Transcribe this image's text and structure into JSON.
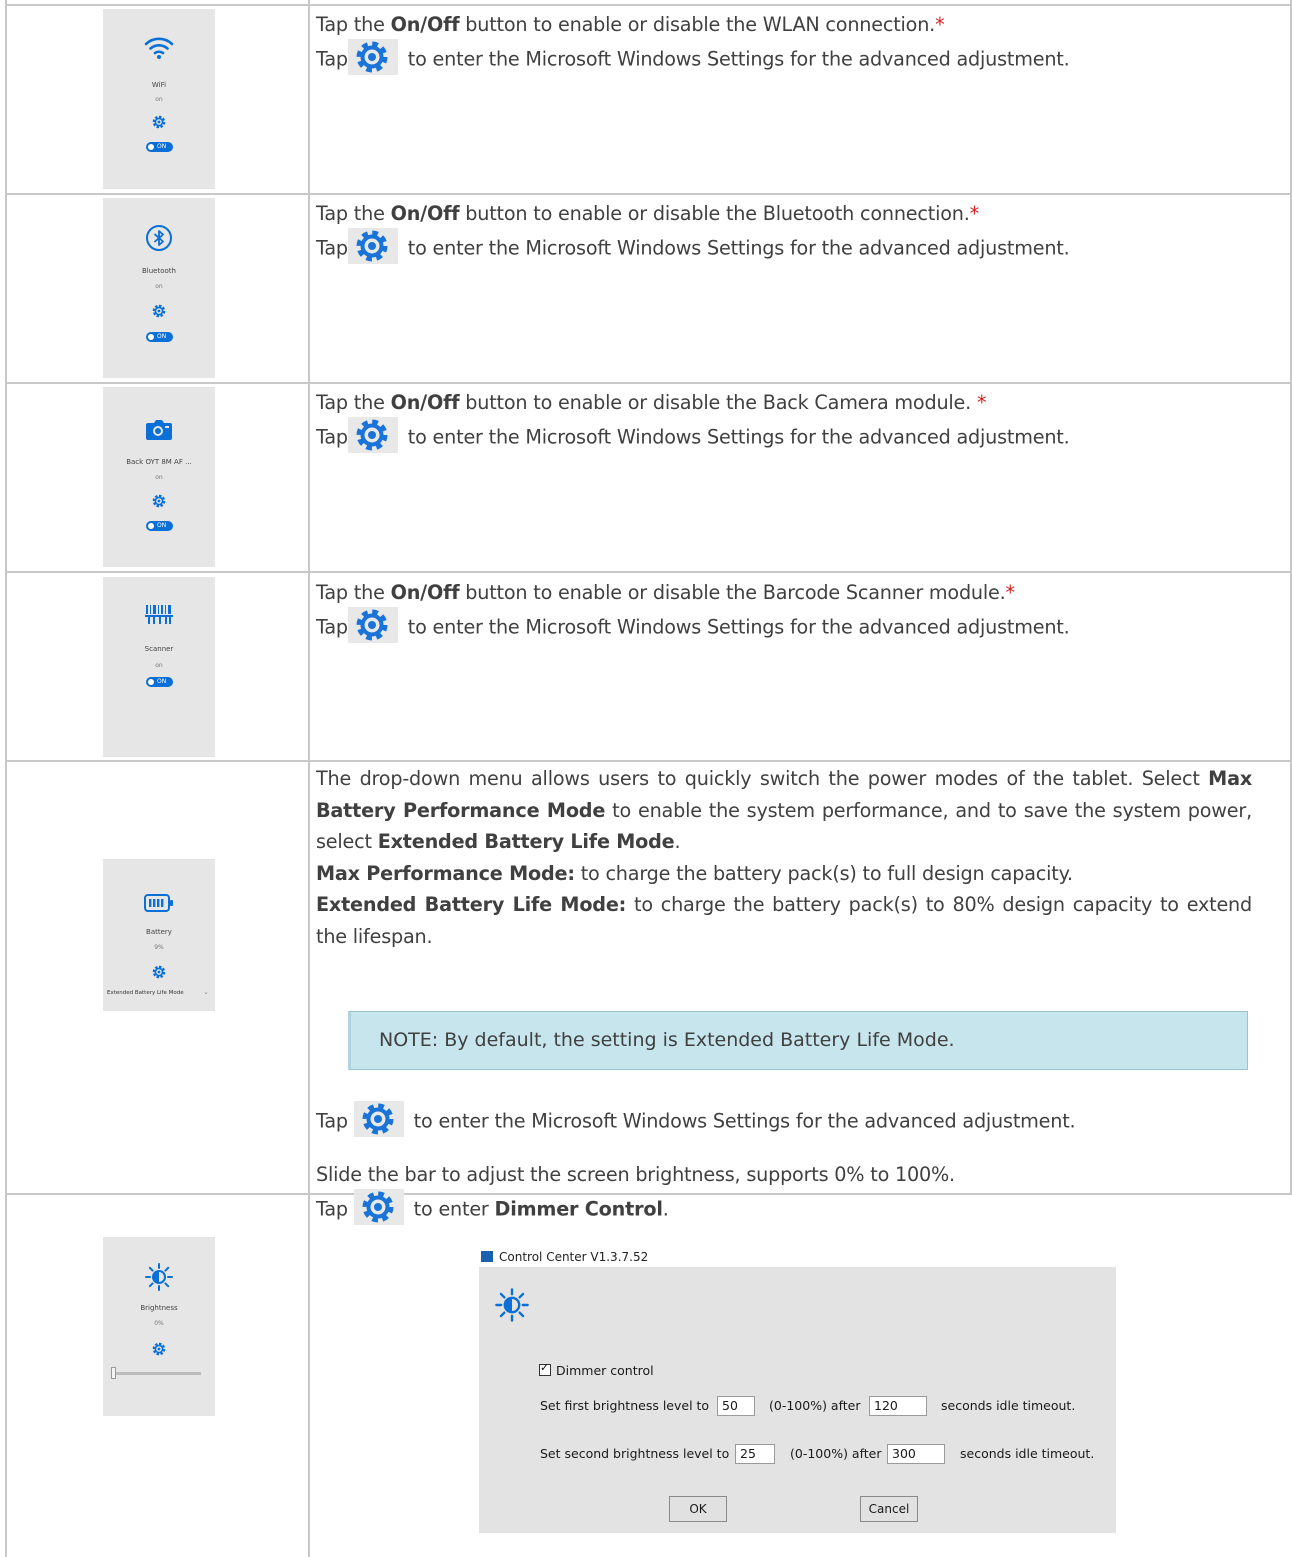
{
  "rows": [
    {
      "tile": {
        "label": "WiFi",
        "state": "on",
        "toggle": "ON"
      },
      "line1_pre": "Tap the ",
      "line1_bold": "On/Off",
      "line1_post": " button to enable or disable the WLAN connection.",
      "star": "*",
      "line2_pre": "Tap",
      "line2_post": " to enter the Microsoft Windows Settings for the advanced adjustment."
    },
    {
      "tile": {
        "label": "Bluetooth",
        "state": "on",
        "toggle": "ON"
      },
      "line1_pre": "Tap the ",
      "line1_bold": "On/Off",
      "line1_post": " button to enable or disable the Bluetooth connection.",
      "star": "*",
      "line2_pre": "Tap",
      "line2_post": " to enter the Microsoft Windows Settings for the advanced adjustment."
    },
    {
      "tile": {
        "label": "Back OYT 8M AF ...",
        "state": "on",
        "toggle": "ON"
      },
      "line1_pre": "Tap the ",
      "line1_bold": "On/Off",
      "line1_post": " button to enable or disable the Back Camera module. ",
      "star": "*",
      "line2_pre": "Tap",
      "line2_post": " to enter the Microsoft Windows Settings for the advanced adjustment."
    },
    {
      "tile": {
        "label": "Scanner",
        "state": "on",
        "toggle": "ON"
      },
      "line1_pre": "Tap the ",
      "line1_bold": "On/Off",
      "line1_post": " button to enable or disable the Barcode Scanner module.",
      "star": "*",
      "line2_pre": "Tap",
      "line2_post": " to enter the Microsoft Windows Settings for the advanced adjustment."
    }
  ],
  "battery": {
    "tile": {
      "label": "Battery",
      "state": "9%",
      "mode": "Extended Battery Life Mode",
      "dropdown_arrow": "⌄"
    },
    "p1_a": "The drop-down menu allows users to quickly switch the power modes of the tablet. Select ",
    "p1_b1": "Max Battery Performance Mode",
    "p1_c": " to enable the system performance, and to save the system power, select ",
    "p1_b2": "Extended Battery Life Mode",
    "p1_d": ".",
    "p2_b": "Max Performance Mode:",
    "p2_t": " to charge the battery pack(s) to full design capacity.",
    "p3_b": "Extended Battery Life Mode:",
    "p3_t": " to charge the battery pack(s) to 80% design capacity to extend the lifespan.",
    "note": "NOTE:  By default, the setting is Extended Battery Life Mode.",
    "tap_pre": "Tap ",
    "tap_post": " to enter the Microsoft Windows Settings for the advanced adjustment."
  },
  "brightness": {
    "tile": {
      "label": "Brightness",
      "state": "0%",
      "slider_level": 0
    },
    "line1": "Slide the bar to adjust the screen brightness, supports 0% to 100%.",
    "line2_pre": "Tap ",
    "line2_mid": " to enter ",
    "line2_bold": "Dimmer Control",
    "line2_post": ".",
    "dialog": {
      "title": "Control Center V1.3.7.52",
      "checkbox_label": "Dimmer control",
      "row1_pre": "Set first brightness level to",
      "row1_level": "50",
      "row1_mid": "(0-100%) after",
      "row1_seconds": "120",
      "row1_post": "seconds idle timeout.",
      "row2_pre": "Set second brightness level to",
      "row2_level": "25",
      "row2_mid": "(0-100%) after",
      "row2_seconds": "300",
      "row2_post": "seconds idle timeout.",
      "ok": "OK",
      "cancel": "Cancel"
    }
  },
  "colors": {
    "accent": "#0a6fd6",
    "gear": "#1a73d9",
    "note_bg": "#c7e5ed",
    "star": "#d62020",
    "grid": "#c8c8c8"
  }
}
